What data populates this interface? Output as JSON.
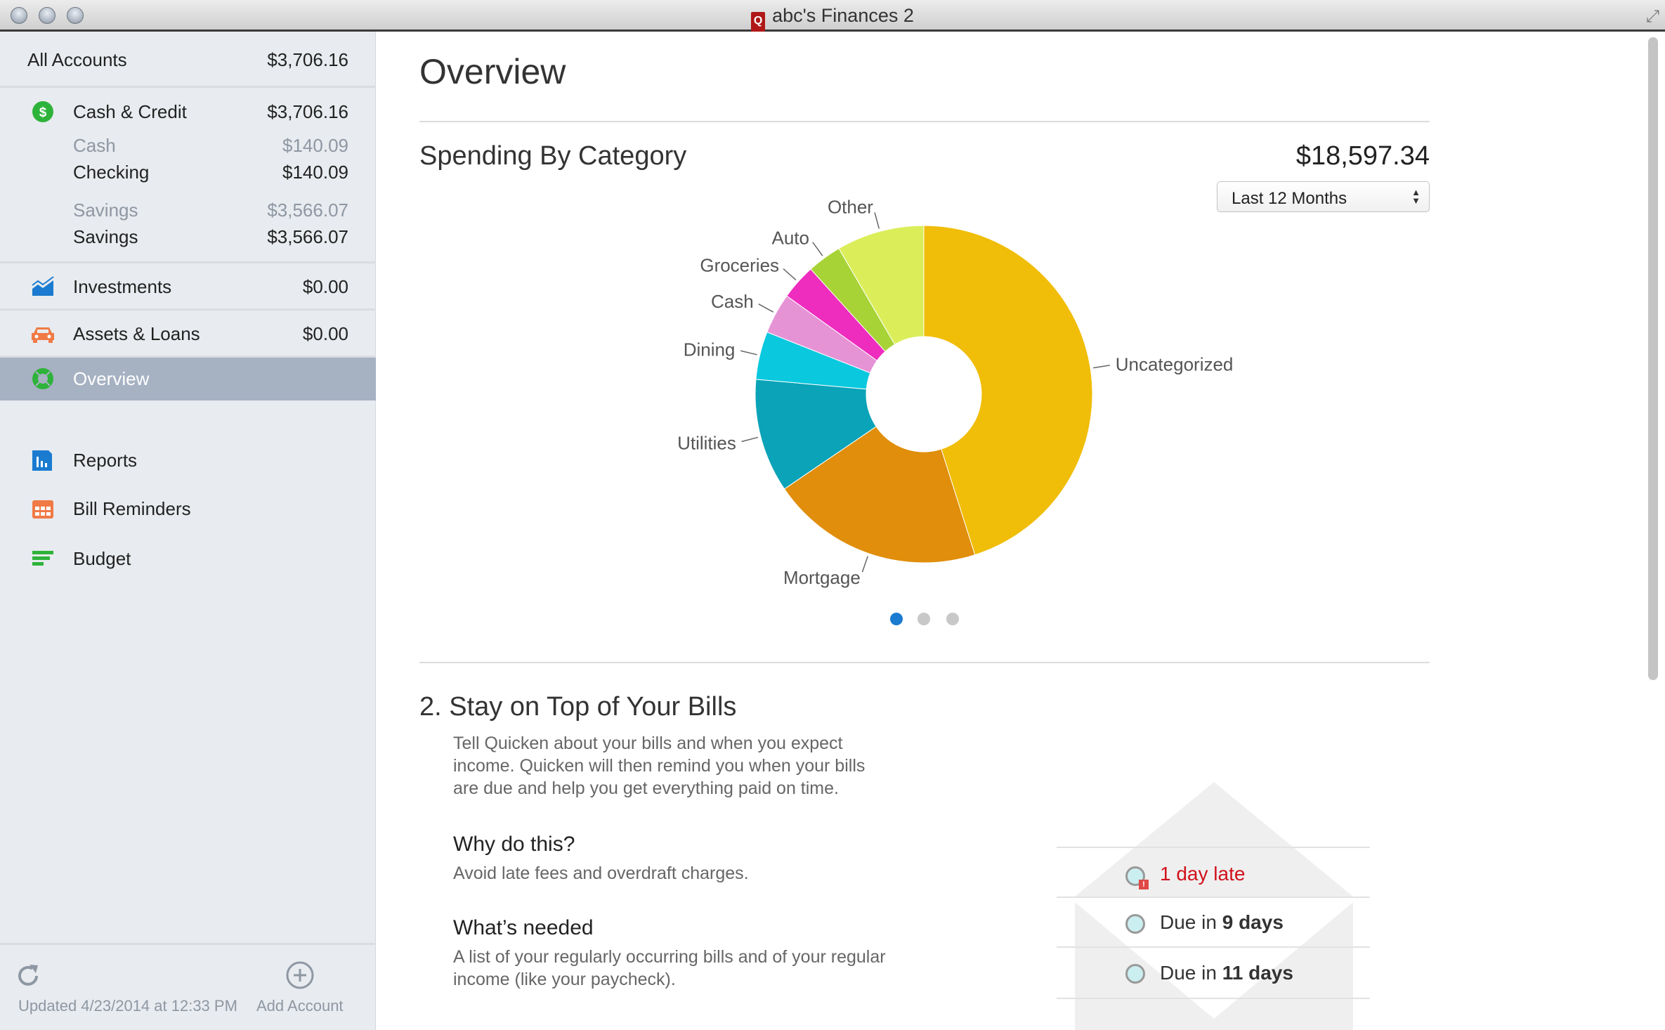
{
  "window": {
    "title": "abc's Finances 2"
  },
  "sidebar": {
    "all_accounts": {
      "label": "All Accounts",
      "value": "$3,706.16"
    },
    "cash_credit": {
      "label": "Cash & Credit",
      "value": "$3,706.16",
      "groups": [
        {
          "type": "Cash",
          "type_value": "$140.09",
          "name": "Checking",
          "value": "$140.09"
        },
        {
          "type": "Savings",
          "type_value": "$3,566.07",
          "name": "Savings",
          "value": "$3,566.07"
        }
      ]
    },
    "investments": {
      "label": "Investments",
      "value": "$0.00"
    },
    "assets_loans": {
      "label": "Assets & Loans",
      "value": "$0.00"
    },
    "nav": [
      {
        "label": "Overview",
        "icon": "overview-icon",
        "selected": true
      },
      {
        "label": "Reports",
        "icon": "reports-icon"
      },
      {
        "label": "Bill Reminders",
        "icon": "calendar-icon"
      },
      {
        "label": "Budget",
        "icon": "budget-icon"
      }
    ],
    "footer": {
      "updated": "Updated 4/23/2014 at 12:33 PM",
      "add_account": "Add Account"
    }
  },
  "main": {
    "title": "Overview",
    "spending": {
      "title": "Spending By Category",
      "total": "$18,597.34",
      "period": "Last 12 Months",
      "page_dots": 3,
      "active_dot": 0
    },
    "bills": {
      "title": "2. Stay on Top of Your Bills",
      "description": [
        "Tell Quicken about your bills and when you expect",
        "income. Quicken will then remind you when your bills",
        "are due and help you get everything paid on time."
      ],
      "why_title": "Why do this?",
      "why_text": "Avoid late fees and overdraft charges.",
      "needed_title": "What’s needed",
      "needed_text": [
        "A list of your regularly occurring bills and of your regular",
        "income (like your paycheck)."
      ],
      "examples": [
        {
          "prefix": "1 day late",
          "bold": "",
          "suffix": "",
          "late": true
        },
        {
          "prefix": "Due in ",
          "bold": "9 days",
          "suffix": "",
          "late": false
        },
        {
          "prefix": "Due in ",
          "bold": "11 days",
          "suffix": "",
          "late": false
        }
      ],
      "late_color": "#d0111b"
    }
  },
  "chart_data": {
    "type": "pie",
    "donut": true,
    "total": 18597.34,
    "categories": [
      "Uncategorized",
      "Mortgage",
      "Utilities",
      "Dining",
      "Cash",
      "Groceries",
      "Auto",
      "Other"
    ],
    "values": [
      8387,
      3794,
      2027,
      855,
      725,
      632,
      614,
      1563
    ],
    "colors": [
      "#f0bd08",
      "#e08e0b",
      "#0aa3b8",
      "#0ac8de",
      "#e693d6",
      "#ee2cbe",
      "#a8d336",
      "#dbee5a"
    ]
  }
}
